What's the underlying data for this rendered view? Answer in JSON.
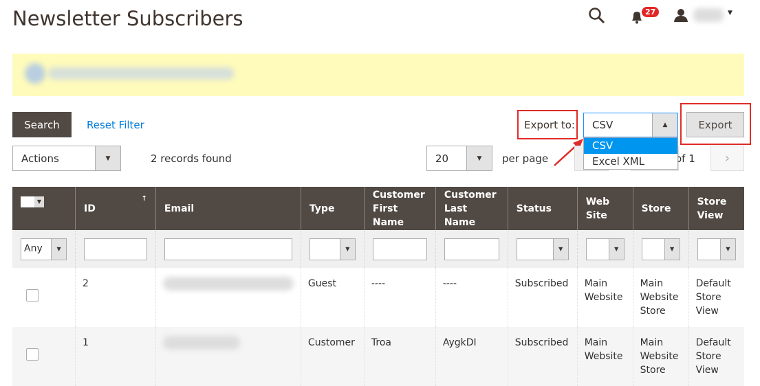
{
  "header": {
    "title": "Newsletter Subscribers",
    "notifications_count": "27",
    "icons": [
      "search-icon",
      "bell-icon",
      "user-icon"
    ]
  },
  "toolbar": {
    "search_label": "Search",
    "reset_filter_label": "Reset Filter",
    "export_to_label": "Export to:",
    "export_format": "CSV",
    "export_options": [
      "CSV",
      "Excel XML"
    ],
    "export_label": "Export",
    "actions_label": "Actions",
    "records_found": "2 records found",
    "per_page_value": "20",
    "per_page_label": "per page",
    "page_of": "of 1"
  },
  "table": {
    "mass_select_value": "Any",
    "columns": [
      "",
      "ID",
      "Email",
      "Type",
      "Customer First Name",
      "Customer Last Name",
      "Status",
      "Web Site",
      "Store",
      "Store View"
    ],
    "rows": [
      {
        "id": "2",
        "type": "Guest",
        "first_name": "----",
        "last_name": "----",
        "status": "Subscribed",
        "website": "Main Website",
        "store": "Main Website Store",
        "store_view": "Default Store View"
      },
      {
        "id": "1",
        "type": "Customer",
        "first_name": "Troa",
        "last_name": "AygkDI",
        "status": "Subscribed",
        "website": "Main Website",
        "store": "Main Website Store",
        "store_view": "Default Store View"
      }
    ]
  },
  "colors": {
    "header_bg": "#514943",
    "link": "#007bdb",
    "highlight": "#e02b27",
    "notice": "#fffbbb",
    "selected_option": "#0096f0"
  }
}
